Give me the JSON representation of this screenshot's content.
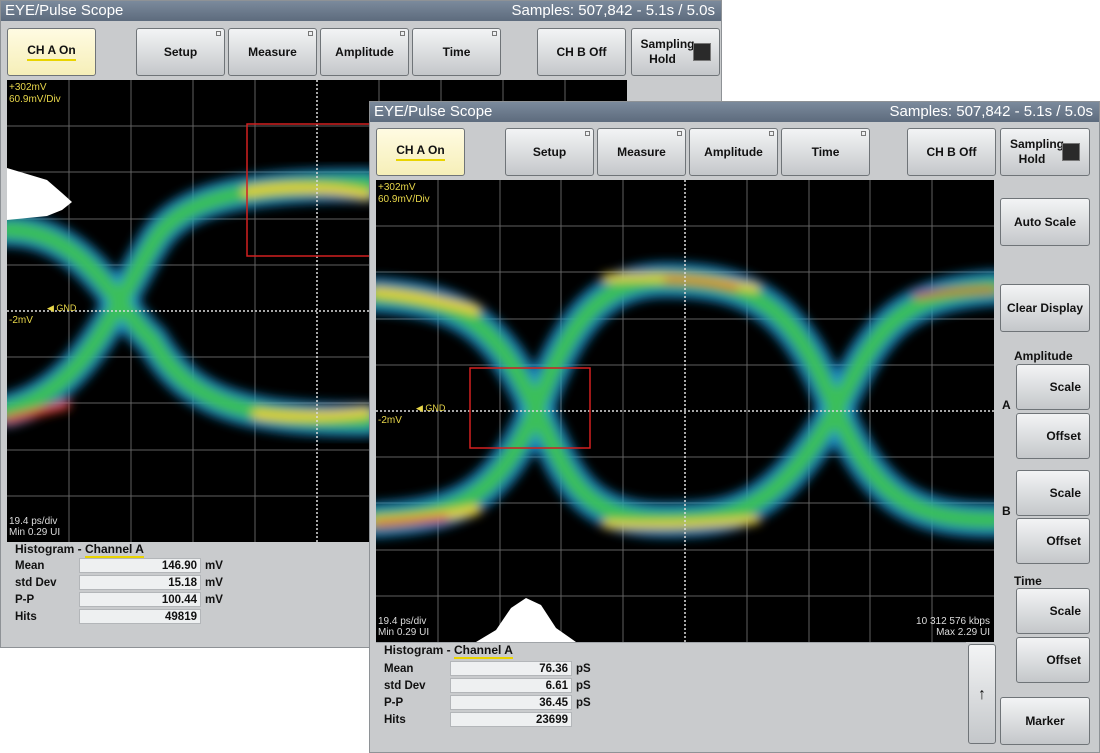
{
  "back": {
    "title": "EYE/Pulse Scope",
    "samples": "Samples: 507,842 - 5.1s / 5.0s",
    "toolbar": {
      "ch_a": "CH A On",
      "setup": "Setup",
      "measure": "Measure",
      "amplitude": "Amplitude",
      "time": "Time",
      "ch_b": "CH B Off",
      "sampling_hold": "Sampling Hold"
    },
    "scale_top": "+302mV",
    "scale_div": "60.9mV/Div",
    "gnd": "GND",
    "level": "-2mV",
    "ps_div": "19.4 ps/div",
    "min_ui": "Min 0.29 UI",
    "histogram": {
      "title": "Histogram - ",
      "channel": "Channel A",
      "rows": [
        {
          "name": "Mean",
          "value": "146.90",
          "unit": "mV"
        },
        {
          "name": "std Dev",
          "value": "15.18",
          "unit": "mV"
        },
        {
          "name": "P-P",
          "value": "100.44",
          "unit": "mV"
        },
        {
          "name": "Hits",
          "value": "49819",
          "unit": ""
        }
      ]
    }
  },
  "front": {
    "title": "EYE/Pulse Scope",
    "samples": "Samples: 507,842 - 5.1s / 5.0s",
    "toolbar": {
      "ch_a": "CH A On",
      "setup": "Setup",
      "measure": "Measure",
      "amplitude": "Amplitude",
      "time": "Time",
      "ch_b": "CH B Off",
      "sampling_hold": "Sampling Hold"
    },
    "scale_top": "+302mV",
    "scale_div": "60.9mV/Div",
    "gnd": "GND",
    "level": "-2mV",
    "ps_div": "19.4 ps/div",
    "min_ui": "Min 0.29 UI",
    "bitrate": "10 312 576 kbps",
    "max_ui": "Max 2.29 UI",
    "histogram": {
      "title": "Histogram - ",
      "channel": "Channel A",
      "rows": [
        {
          "name": "Mean",
          "value": "76.36",
          "unit": "pS"
        },
        {
          "name": "std Dev",
          "value": "6.61",
          "unit": "pS"
        },
        {
          "name": "P-P",
          "value": "36.45",
          "unit": "pS"
        },
        {
          "name": "Hits",
          "value": "23699",
          "unit": ""
        }
      ]
    },
    "sidebar": {
      "auto_scale": "Auto Scale",
      "clear_display": "Clear Display",
      "amplitude_label": "Amplitude",
      "a_marker": "A",
      "b_marker": "B",
      "scale_a": "Scale",
      "offset_a": "Offset",
      "scale_b": "Scale",
      "offset_b": "Offset",
      "time_label": "Time",
      "scale_t": "Scale",
      "offset_t": "Offset",
      "marker": "Marker",
      "scroll_arrow": "↑"
    }
  },
  "colors": {
    "trace_low": "#1a8fd0",
    "trace_mid": "#3bbf5a",
    "trace_high": "#e8d22a",
    "trace_peak": "#e0402a",
    "marker_box": "#d22020",
    "accent": "#e9d400"
  }
}
